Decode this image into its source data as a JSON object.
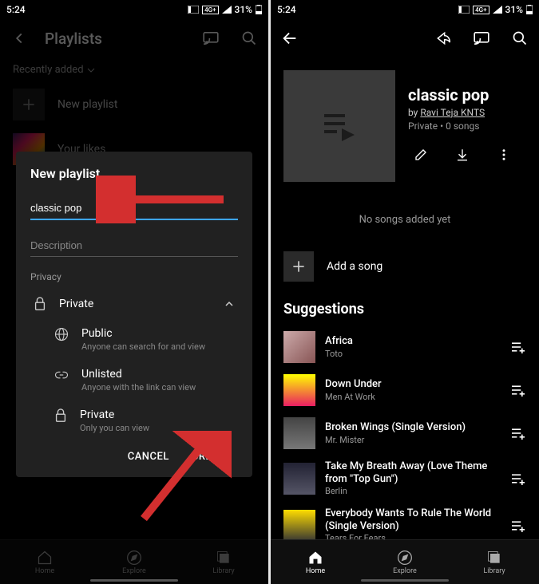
{
  "status": {
    "time": "5:24",
    "battery": "31%"
  },
  "left": {
    "title": "Playlists",
    "filter": "Recently added",
    "newPlaylist": "New playlist",
    "yourLikes": "Your likes",
    "dialog": {
      "heading": "New playlist",
      "name_value": "classic pop",
      "desc_placeholder": "Description",
      "privacy_label": "Privacy",
      "selected": "Private",
      "options": [
        {
          "name": "Public",
          "desc": "Anyone can search for and view"
        },
        {
          "name": "Unlisted",
          "desc": "Anyone with the link can view"
        },
        {
          "name": "Private",
          "desc": "Only you can view"
        }
      ],
      "cancel": "CANCEL",
      "create": "CREATE"
    },
    "nav": {
      "home": "Home",
      "explore": "Explore",
      "library": "Library"
    }
  },
  "right": {
    "playlist": {
      "title": "classic pop",
      "by_prefix": "by ",
      "author": "Ravi Teja KNTS",
      "status": "Private • 0 songs"
    },
    "empty": "No songs added yet",
    "add": "Add a song",
    "suggestions_heading": "Suggestions",
    "songs": [
      {
        "title": "Africa",
        "artist": "Toto",
        "thumb": "africa"
      },
      {
        "title": "Down Under",
        "artist": "Men At Work",
        "thumb": "80s"
      },
      {
        "title": "Broken Wings (Single Version)",
        "artist": "Mr. Mister",
        "thumb": "wings"
      },
      {
        "title": "Take My Breath Away (Love Theme from \"Top Gun\")",
        "artist": "Berlin",
        "thumb": "topgun"
      },
      {
        "title": "Everybody Wants To Rule The World (Single Version)",
        "artist": "Tears For Fears",
        "thumb": "tff"
      }
    ],
    "nav": {
      "home": "Home",
      "explore": "Explore",
      "library": "Library"
    }
  }
}
